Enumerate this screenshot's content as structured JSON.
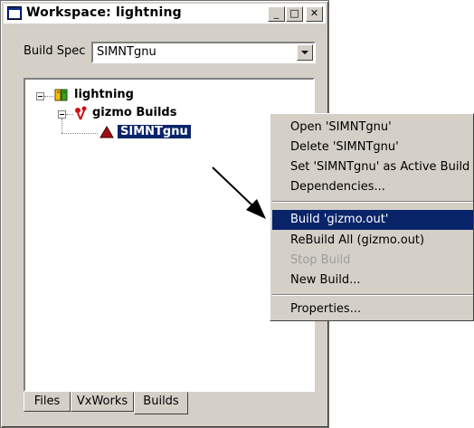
{
  "window": {
    "title": "Workspace: lightning",
    "controls": {
      "minimize": "_",
      "maximize": "□",
      "close": "✕"
    }
  },
  "build_spec": {
    "label": "Build Spec",
    "value": "SIMNTgnu"
  },
  "tree": {
    "root": {
      "label": "lightning",
      "icon": "project-icon"
    },
    "child": {
      "label": "gizmo Builds",
      "icon": "builds-icon"
    },
    "leaf": {
      "label": "SIMNTgnu",
      "icon": "build-target-icon"
    }
  },
  "tabs": [
    "Files",
    "VxWorks",
    "Builds"
  ],
  "active_tab": "Builds",
  "context_menu": {
    "items": [
      {
        "label": "Open 'SIMNTgnu'",
        "state": "normal"
      },
      {
        "label": "Delete 'SIMNTgnu'",
        "state": "normal"
      },
      {
        "label": "Set 'SIMNTgnu' as Active Build",
        "state": "normal"
      },
      {
        "label": "Dependencies...",
        "state": "normal"
      },
      {
        "label": "Build 'gizmo.out'",
        "state": "highlighted"
      },
      {
        "label": "ReBuild All (gizmo.out)",
        "state": "normal"
      },
      {
        "label": "Stop Build",
        "state": "disabled"
      },
      {
        "label": "New Build...",
        "state": "normal"
      },
      {
        "label": "Properties...",
        "state": "normal"
      }
    ]
  },
  "colors": {
    "selection": "#0a246a",
    "chrome": "#d4d0c8",
    "disabled_text": "#9c9c9c"
  }
}
